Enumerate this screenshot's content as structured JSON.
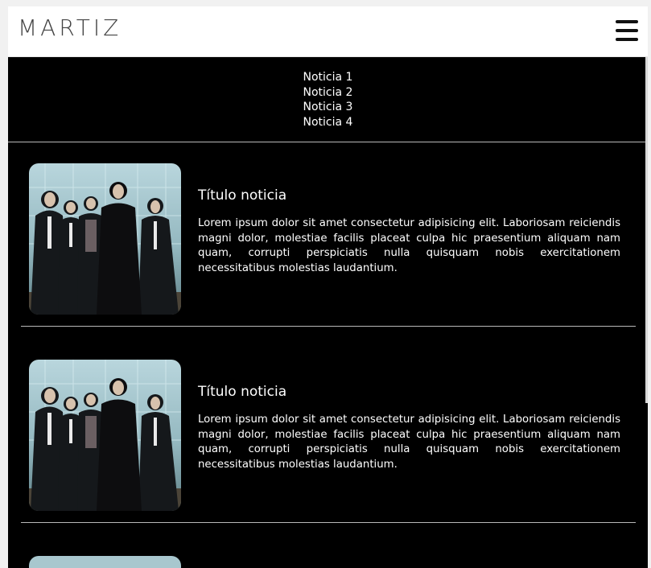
{
  "header": {
    "logo": "MARTIZ",
    "menu_icon": "hamburger-menu-icon"
  },
  "news_menu": {
    "items": [
      "Noticia 1",
      "Noticia 2",
      "Noticia 3",
      "Noticia 4"
    ]
  },
  "articles": [
    {
      "title": "Título noticia",
      "body": "Lorem ipsum dolor sit amet consectetur adipisicing elit. Laboriosam reiciendis magni dolor, molestiae facilis placeat culpa hic praesentium aliquam nam quam, corrupti perspiciatis nulla quisquam nobis exercitationem necessitatibus molestias laudantium."
    },
    {
      "title": "Título noticia",
      "body": "Lorem ipsum dolor sit amet consectetur adipisicing elit. Laboriosam reiciendis magni dolor, molestiae facilis placeat culpa hic praesentium aliquam nam quam, corrupti perspiciatis nulla quisquam nobis exercitationem necessitatibus molestias laudantium."
    }
  ],
  "colors": {
    "background": "#000000",
    "header_background": "#ffffff",
    "text": "#ffffff",
    "divider": "#b9b9b9"
  }
}
